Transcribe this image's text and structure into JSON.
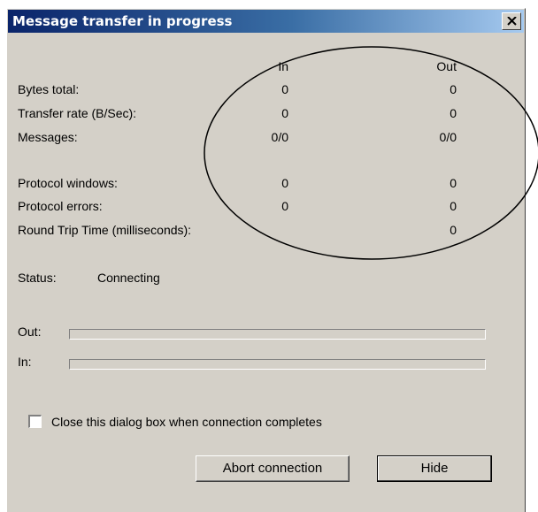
{
  "dialog": {
    "title": "Message transfer in progress",
    "close_label": "×"
  },
  "columns": {
    "in": "In",
    "out": "Out"
  },
  "stats": [
    {
      "label": "Bytes total:",
      "in": "0",
      "out": "0"
    },
    {
      "label": "Transfer rate (B/Sec):",
      "in": "0",
      "out": "0"
    },
    {
      "label": "Messages:",
      "in": "0/0",
      "out": "0/0"
    },
    {
      "label": "Protocol windows:",
      "in": "0",
      "out": "0"
    },
    {
      "label": "Protocol errors:",
      "in": "0",
      "out": "0"
    },
    {
      "label": "Round Trip Time (milliseconds):",
      "in": "",
      "out": "0"
    }
  ],
  "status": {
    "label": "Status:",
    "value": "Connecting"
  },
  "progress": {
    "out_label": "Out:",
    "out_fraction": 0,
    "in_label": "In:",
    "in_fraction": 0
  },
  "checkbox": {
    "label": "Close this dialog box when connection completes",
    "checked": false
  },
  "buttons": {
    "abort": "Abort connection",
    "hide": "Hide"
  },
  "colors": {
    "titlebar_start": "#0a246a",
    "titlebar_end": "#a6caf0",
    "face": "#d4d0c8"
  }
}
